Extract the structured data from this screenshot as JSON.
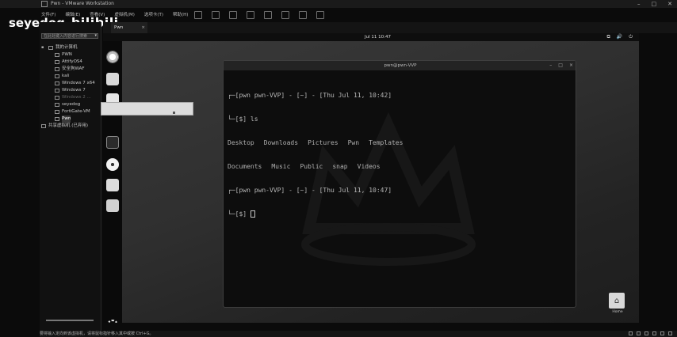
{
  "window": {
    "title": "Pwn - VMware Workstation",
    "controls": [
      "–",
      "□",
      "✕"
    ]
  },
  "watermark": {
    "user": "seyedog",
    "site": "bilibili"
  },
  "menubar": [
    "文件(F)",
    "编辑(E)",
    "查看(V)",
    "虚拟机(M)",
    "选项卡(T)",
    "帮助(H)"
  ],
  "library": {
    "search_placeholder": "在此处键入内容进行搜索",
    "root": "我的计算机",
    "items": [
      {
        "label": "PWN"
      },
      {
        "label": "AttifyOS4"
      },
      {
        "label": "安全狗WAF"
      },
      {
        "label": "kali"
      },
      {
        "label": "Windows 7 x64"
      },
      {
        "label": "Windows 7"
      },
      {
        "label": "Windows 2 ..."
      },
      {
        "label": "seyedog"
      },
      {
        "label": "FortiGate-VM"
      },
      {
        "label": "Pwn"
      }
    ],
    "shared": "共享虚拟机 (已弃用)"
  },
  "tab": {
    "label": "Pwn",
    "close": "×"
  },
  "guest": {
    "clock": "Jul 11  10:47",
    "sys_icons": [
      "⧉",
      "🔊",
      "⏻"
    ],
    "home_label": "Home"
  },
  "terminal": {
    "title": "pwn@pwn-VVP",
    "window_buttons": [
      "–",
      "□",
      "×"
    ],
    "lines": [
      "┌─[pwn pwn-VVP] - [~] - [Thu Jul 11, 10:42]",
      "└─[$] ls"
    ],
    "ls_row1": [
      "Desktop",
      "Downloads",
      "Pictures",
      "Pwn",
      "Templates"
    ],
    "ls_row2": [
      "Documents",
      "Music",
      "Public",
      "snap",
      "Videos"
    ],
    "lines2": [
      "┌─[pwn pwn-VVP] - [~] - [Thu Jul 11, 10:47]",
      "└─[$] "
    ]
  },
  "statusbar": {
    "text": "要将输入定向到该虚拟机，请将鼠标指针移入其中或按 Ctrl+G。"
  }
}
